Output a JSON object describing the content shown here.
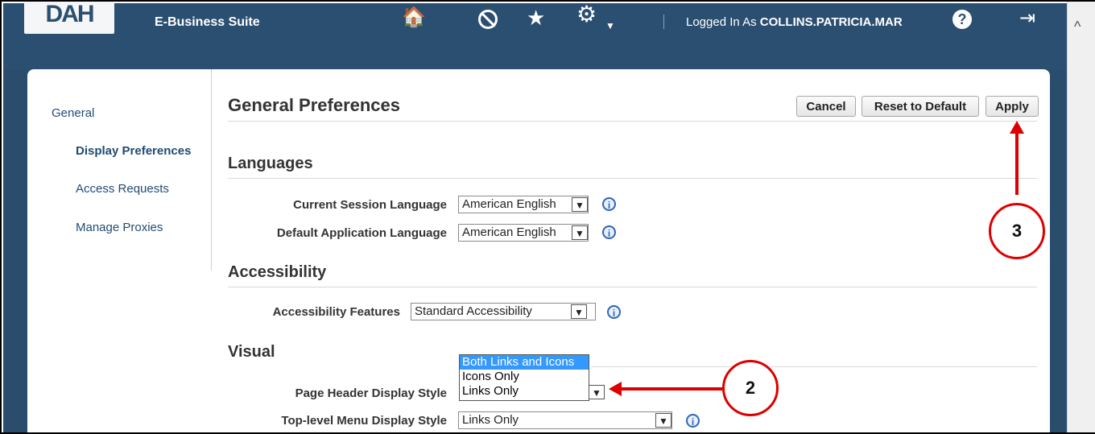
{
  "header": {
    "logo_text": "DAH",
    "suite_title": "E-Business Suite",
    "logged_prefix": "Logged In As",
    "username": "COLLINS.PATRICIA.MAR",
    "icons": [
      "home-icon",
      "no-entry-icon",
      "favorites-star-icon",
      "settings-gear-icon",
      "help-icon",
      "logout-icon"
    ],
    "icon_glyphs": {
      "home": "🏠",
      "star": "★",
      "gear": "⚙",
      "caret": "▼",
      "help": "?",
      "exit": "⇥",
      "scroll_up": "^"
    }
  },
  "sidebar": {
    "items": [
      {
        "label": "General"
      },
      {
        "label": "Display Preferences"
      },
      {
        "label": "Access Requests"
      },
      {
        "label": "Manage Proxies"
      }
    ]
  },
  "main": {
    "title": "General Preferences",
    "buttons": {
      "cancel": "Cancel",
      "reset": "Reset to Default",
      "apply": "Apply"
    },
    "sections": {
      "languages": "Languages",
      "accessibility": "Accessibility",
      "visual": "Visual"
    },
    "fields": {
      "current_session_language": {
        "label": "Current Session Language",
        "value": "American English"
      },
      "default_application_language": {
        "label": "Default Application Language",
        "value": "American English"
      },
      "accessibility_features": {
        "label": "Accessibility Features",
        "value": "Standard Accessibility"
      },
      "page_header_display_style": {
        "label": "Page Header Display Style",
        "options": [
          "Both Links and Icons",
          "Icons Only",
          "Links Only"
        ],
        "highlighted": "Both Links and Icons"
      },
      "top_level_menu_display_style": {
        "label": "Top-level Menu Display Style",
        "value": "Links Only"
      }
    }
  },
  "annotations": {
    "callout_2": "2",
    "callout_3": "3"
  },
  "colors": {
    "header_bg": "#2b4f71",
    "nav_link": "#1f4b73",
    "callout_red": "#dd0000",
    "selection_blue": "#3399ff"
  }
}
